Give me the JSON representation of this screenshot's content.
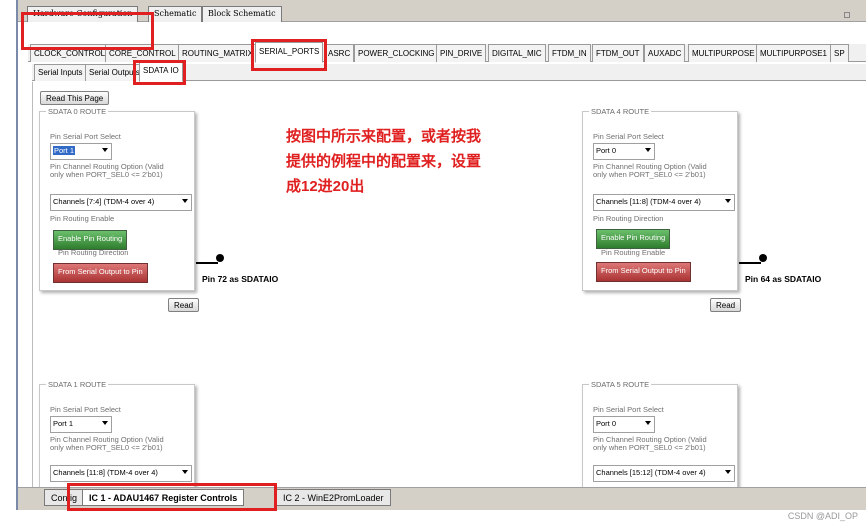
{
  "top_tabs": [
    "Hardware Configuration",
    "Schematic",
    "Block Schematic"
  ],
  "main_tabs": [
    "CLOCK_CONTROL",
    "CORE_CONTROL",
    "ROUTING_MATRIX",
    "SERIAL_PORTS",
    "ASRC",
    "POWER_CLOCKING",
    "PIN_DRIVE",
    "DIGITAL_MIC",
    "FTDM_IN",
    "FTDM_OUT",
    "AUXADC",
    "MULTIPURPOSE",
    "MULTIPURPOSE1",
    "SP"
  ],
  "sub_tabs": [
    "Serial Inputs",
    "Serial Outputs",
    "SDATA IO"
  ],
  "read_page_label": "Read This Page",
  "read_label": "Read",
  "labels": {
    "port_select": "Pin Serial Port Select",
    "routing_option_1": "Pin Channel Routing Option (Valid",
    "routing_option_2": "only when PORT_SEL0 <= 2'b01)",
    "routing_enable": "Pin Routing Enable",
    "routing_direction": "Pin Routing Direction"
  },
  "panels": {
    "sdata0": {
      "title": "SDATA 0 ROUTE",
      "port": "Port 1",
      "channels": "Channels [7:4] (TDM-4 over 4)",
      "enable_btn": "Enable Pin Routing",
      "direction_btn": "From Serial Output to Pin",
      "pin_label": "Pin 72 as SDATAIO"
    },
    "sdata4": {
      "title": "SDATA 4 ROUTE",
      "port": "Port 0",
      "channels": "Channels [11:8] (TDM-4 over 4)",
      "enable_btn": "Enable Pin Routing",
      "direction_btn": "From Serial Output to Pin",
      "pin_label": "Pin 64 as SDATAIO"
    },
    "sdata1": {
      "title": "SDATA 1 ROUTE",
      "port": "Port 1",
      "channels": "Channels [11:8] (TDM-4 over 4)"
    },
    "sdata5": {
      "title": "SDATA 5 ROUTE",
      "port": "Port 0",
      "channels": "Channels [15:12] (TDM-4 over 4)"
    }
  },
  "annotation": [
    "按图中所示来配置，或者按我",
    "提供的例程中的配置来，设置",
    "成12进20出"
  ],
  "bottom_tabs": [
    "Config",
    "IC 1 - ADAU1467 Register Controls",
    "IC 2 - WinE2PromLoader"
  ],
  "watermark": "CSDN @ADI_OP",
  "colors": {
    "highlight": "#e02020",
    "enable_button": "#2e7d2e",
    "direction_button": "#a33333"
  }
}
